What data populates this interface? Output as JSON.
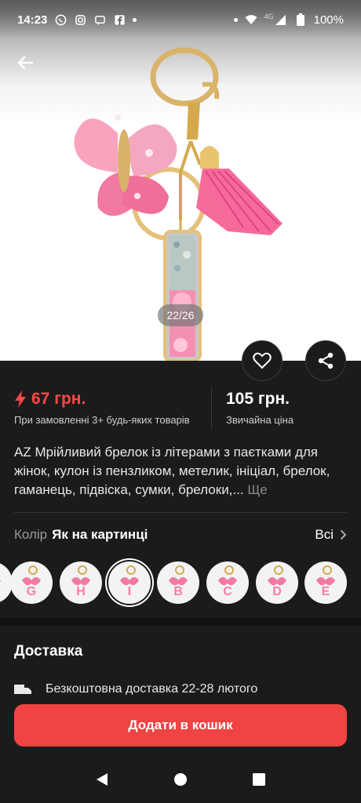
{
  "status_bar": {
    "time": "14:23",
    "network": "4G",
    "battery": "100%"
  },
  "hero": {
    "image_counter": "22/26"
  },
  "price": {
    "promo_price": "67 грн.",
    "promo_note": "При замовленні 3+ будь-яких товарів",
    "regular_price": "105 грн.",
    "regular_note": "Звичайна ціна"
  },
  "product": {
    "title": "AZ Мрійливий брелок із літерами з паєтками для жінок, кулон із пензликом, метелик, ініціал, брелок, гаманець, підвіска, сумки, брелоки,...",
    "more_label": "Ще"
  },
  "color": {
    "label": "Колір",
    "value": "Як на картинці",
    "all_label": "Всі"
  },
  "swatches": [
    {
      "letter": "",
      "selected": false
    },
    {
      "letter": "G",
      "selected": false
    },
    {
      "letter": "H",
      "selected": false
    },
    {
      "letter": "I",
      "selected": true
    },
    {
      "letter": "B",
      "selected": false
    },
    {
      "letter": "C",
      "selected": false
    },
    {
      "letter": "D",
      "selected": false
    },
    {
      "letter": "E",
      "selected": false
    }
  ],
  "delivery": {
    "title": "Доставка",
    "line": "Безкоштовна доставка 22-28 лютого"
  },
  "cart_button": "Додати в кошик",
  "colors": {
    "accent": "#f04444",
    "promo": "#ff4747",
    "background": "#1b1b1b"
  }
}
